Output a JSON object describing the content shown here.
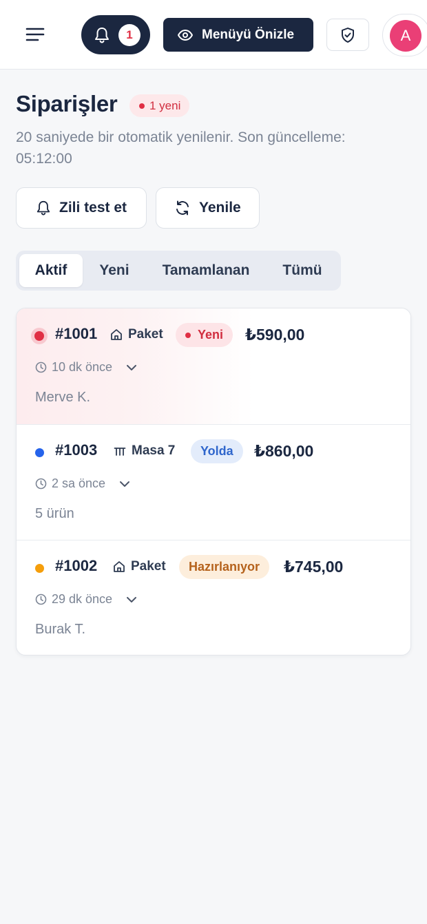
{
  "topbar": {
    "notification_count": "1",
    "preview_label": "Menüyü Önizle",
    "avatar_initial": "A"
  },
  "header": {
    "title": "Siparişler",
    "new_badge": "1 yeni",
    "subtitle": "20 saniyede bir otomatik yenilenir. Son güncelleme: 05:12:00"
  },
  "actions": {
    "test_bell": "Zili test et",
    "refresh": "Yenile"
  },
  "tabs": [
    {
      "label": "Aktif",
      "active": true
    },
    {
      "label": "Yeni",
      "active": false
    },
    {
      "label": "Tamamlanan",
      "active": false
    },
    {
      "label": "Tümü",
      "active": false
    }
  ],
  "orders": [
    {
      "id": "#1001",
      "type_icon": "home-icon",
      "type_label": "Paket",
      "status": "Yeni",
      "status_color": "#e02f44",
      "price": "₺590,00",
      "time": "10 dk önce",
      "detail": "Merve K."
    },
    {
      "id": "#1003",
      "type_icon": "table-icon",
      "type_label": "Masa 7",
      "status": "Yolda",
      "status_color": "#2563eb",
      "price": "₺860,00",
      "time": "2 sa önce",
      "detail": "5 ürün"
    },
    {
      "id": "#1002",
      "type_icon": "home-icon",
      "type_label": "Paket",
      "status": "Hazırlanıyor",
      "status_color": "#f59e0b",
      "price": "₺745,00",
      "time": "29 dk önce",
      "detail": "Burak T."
    }
  ]
}
